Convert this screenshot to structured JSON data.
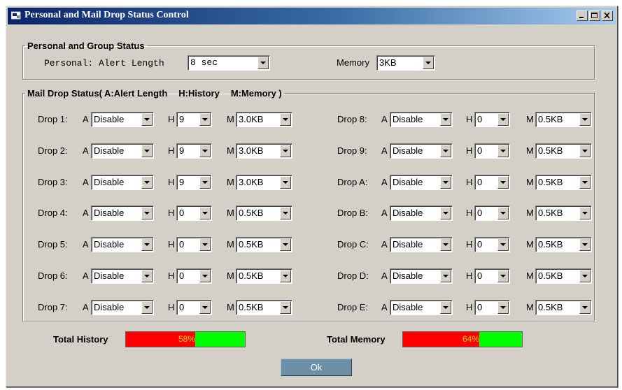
{
  "window": {
    "title": "Personal and Mail Drop Status Control"
  },
  "personal_group": {
    "legend": "Personal and Group Status",
    "alert_label": "Personal: Alert Length",
    "alert_value": "8 sec",
    "memory_label": "Memory",
    "memory_value": "3KB"
  },
  "mail_drop": {
    "legend_parts": [
      "Mail Drop Status( A:Alert Length",
      "H:History",
      "M:Memory )"
    ],
    "a_label": "A",
    "h_label": "H",
    "m_label": "M",
    "drops": [
      {
        "label": "Drop 1:",
        "a": "Disable",
        "h": "9",
        "m": "3.0KB"
      },
      {
        "label": "Drop 2:",
        "a": "Disable",
        "h": "9",
        "m": "3.0KB"
      },
      {
        "label": "Drop 3:",
        "a": "Disable",
        "h": "9",
        "m": "3.0KB"
      },
      {
        "label": "Drop 4:",
        "a": "Disable",
        "h": "0",
        "m": "0.5KB"
      },
      {
        "label": "Drop 5:",
        "a": "Disable",
        "h": "0",
        "m": "0.5KB"
      },
      {
        "label": "Drop 6:",
        "a": "Disable",
        "h": "0",
        "m": "0.5KB"
      },
      {
        "label": "Drop 7:",
        "a": "Disable",
        "h": "0",
        "m": "0.5KB"
      },
      {
        "label": "Drop 8:",
        "a": "Disable",
        "h": "0",
        "m": "0.5KB"
      },
      {
        "label": "Drop 9:",
        "a": "Disable",
        "h": "0",
        "m": "0.5KB"
      },
      {
        "label": "Drop A:",
        "a": "Disable",
        "h": "0",
        "m": "0.5KB"
      },
      {
        "label": "Drop B:",
        "a": "Disable",
        "h": "0",
        "m": "0.5KB"
      },
      {
        "label": "Drop C:",
        "a": "Disable",
        "h": "0",
        "m": "0.5KB"
      },
      {
        "label": "Drop D:",
        "a": "Disable",
        "h": "0",
        "m": "0.5KB"
      },
      {
        "label": "Drop E:",
        "a": "Disable",
        "h": "0",
        "m": "0.5KB"
      }
    ]
  },
  "totals": {
    "history_label": "Total History",
    "history_percent_text": "58%",
    "history_fraction": 0.58,
    "memory_label": "Total Memory",
    "memory_percent_text": "64%",
    "memory_fraction": 0.64
  },
  "colors": {
    "used": "#ff0000",
    "free": "#00ff00",
    "title_bar": "#0a246a"
  },
  "ok_button": {
    "label": "Ok"
  }
}
